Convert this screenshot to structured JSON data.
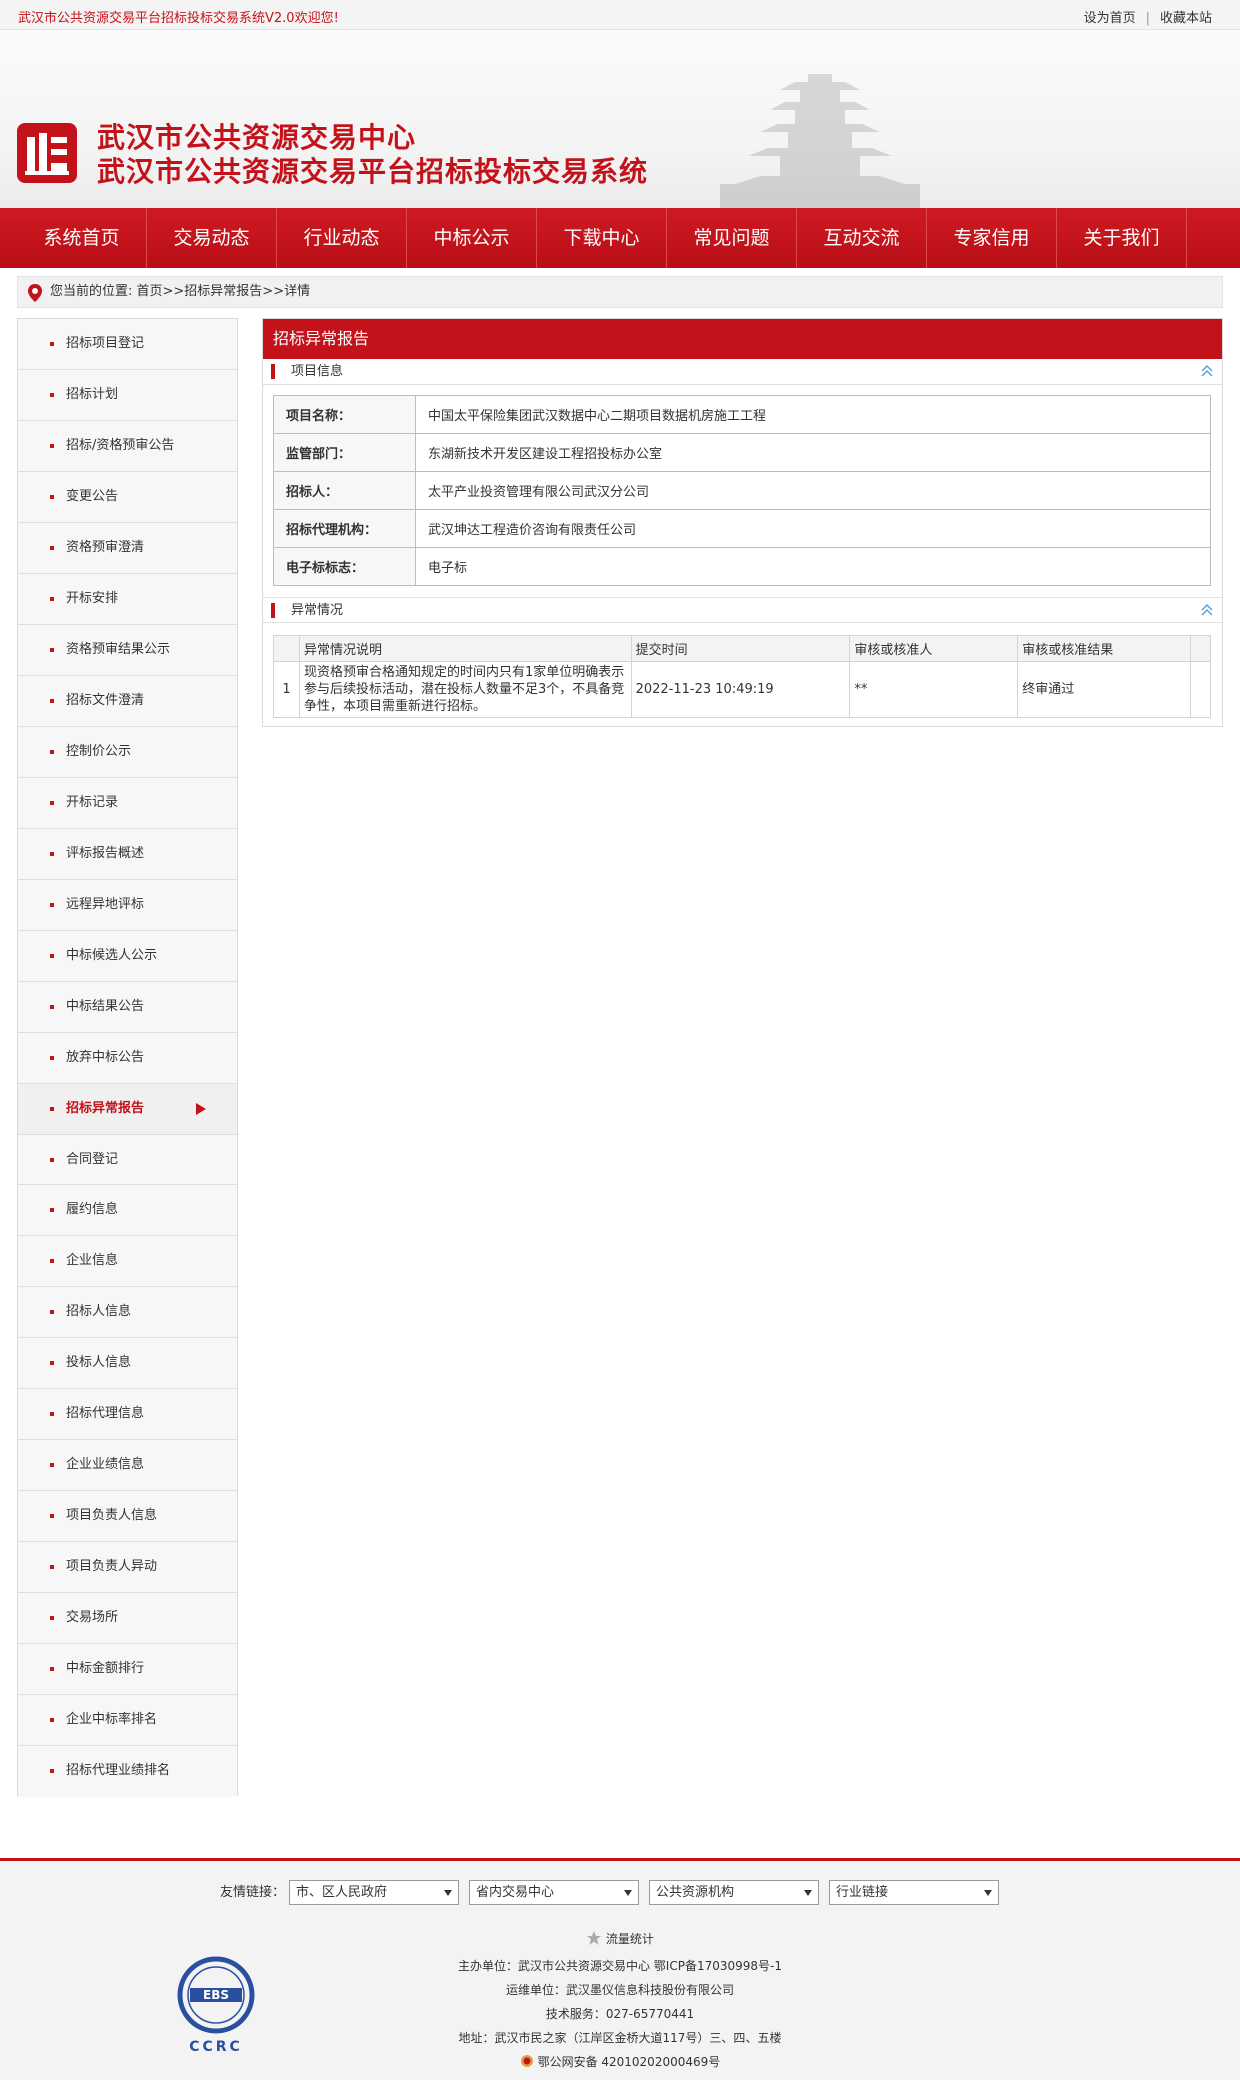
{
  "topbar": {
    "welcome": "武汉市公共资源交易平台招标投标交易系统V2.0欢迎您!",
    "set_home": "设为首页",
    "separator": "|",
    "bookmark": "收藏本站"
  },
  "header": {
    "title_line1": "武汉市公共资源交易中心",
    "title_line2": "武汉市公共资源交易平台招标投标交易系统",
    "brand_color": "#c3121a"
  },
  "nav": {
    "items": [
      "系统首页",
      "交易动态",
      "行业动态",
      "中标公示",
      "下载中心",
      "常见问题",
      "互动交流",
      "专家信用",
      "关于我们"
    ]
  },
  "breadcrumb": {
    "text": "您当前的位置: 首页>>招标异常报告>>详情"
  },
  "sidebar": {
    "items": [
      "招标项目登记",
      "招标计划",
      "招标/资格预审公告",
      "变更公告",
      "资格预审澄清",
      "开标安排",
      "资格预审结果公示",
      "招标文件澄清",
      "控制价公示",
      "开标记录",
      "评标报告概述",
      "远程异地评标",
      "中标候选人公示",
      "中标结果公告",
      "放弃中标公告",
      "招标异常报告",
      "合同登记",
      "履约信息",
      "企业信息",
      "招标人信息",
      "投标人信息",
      "招标代理信息",
      "企业业绩信息",
      "项目负责人信息",
      "项目负责人异动",
      "交易场所",
      "中标金额排行",
      "企业中标率排名",
      "招标代理业绩排名"
    ],
    "active": "招标异常报告"
  },
  "panel": {
    "title": "招标异常报告",
    "section1": "项目信息",
    "section2": "异常情况",
    "info": [
      {
        "k": "项目名称：",
        "v": "中国太平保险集团武汉数据中心二期项目数据机房施工工程"
      },
      {
        "k": "监管部门：",
        "v": "东湖新技术开发区建设工程招投标办公室"
      },
      {
        "k": "招标人：",
        "v": "太平产业投资管理有限公司武汉分公司"
      },
      {
        "k": "招标代理机构：",
        "v": "武汉坤达工程造价咨询有限责任公司"
      },
      {
        "k": "电子标标志：",
        "v": "电子标"
      }
    ],
    "abn_headers": [
      "异常情况说明",
      "提交时间",
      "审核或核准人",
      "审核或核准结果"
    ],
    "abn_rows": [
      {
        "no": "1",
        "desc": "现资格预审合格通知规定的时间内只有1家单位明确表示参与后续投标活动，潜在投标人数量不足3个，不具备竞争性，本项目需重新进行招标。",
        "time": "2022-11-23 10:49:19",
        "reviewer": "**",
        "result": "终审通过"
      }
    ]
  },
  "footer": {
    "friend_label": "友情链接：",
    "selects": [
      "市、区人民政府",
      "省内交易中心",
      "公共资源机构",
      "行业链接"
    ],
    "stats": "流量统计",
    "host": "主办单位：武汉市公共资源交易中心 鄂ICP备17030998号-1",
    "operator": "运维单位：武汉墨仪信息科技股份有限公司",
    "support": "技术服务：027-65770441",
    "address": "地址：武汉市民之家（江岸区金桥大道117号）三、四、五楼",
    "police": "鄂公网安备 42010202000469号",
    "ebs_logo_text": "EBS",
    "ccrc_text": "CCRC"
  }
}
